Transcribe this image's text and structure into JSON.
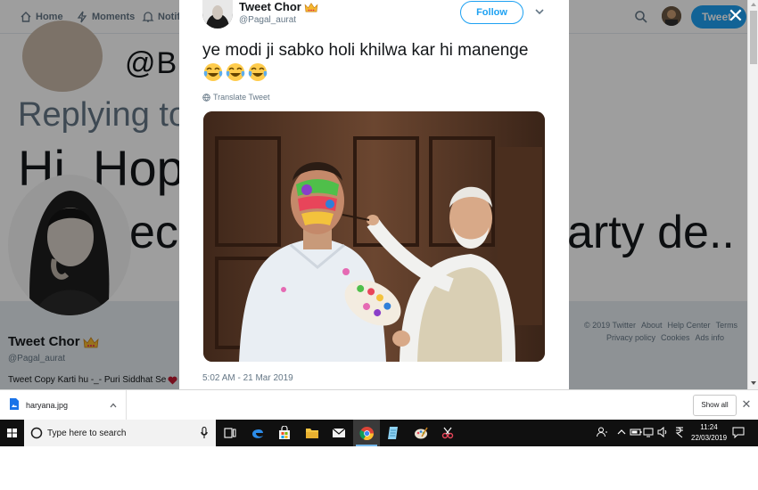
{
  "background_page": {
    "nav": {
      "home": "Home",
      "moments": "Moments",
      "notifications": "Notif",
      "tweet_button": "Tweet"
    },
    "banner": {
      "handle_fragment": "@Bi",
      "replying_to": "Replying to @",
      "hope_text": "Hi, Hope",
      "line2_left": "ec",
      "line2_right": "arty de.."
    },
    "profile": {
      "name": "Tweet Chor",
      "handle": "@Pagal_aurat",
      "bio": "Tweet Copy Karti hu -_- Puri Siddhat Se"
    },
    "footer": {
      "links": [
        "© 2019 Twitter",
        "About",
        "Help Center",
        "Terms",
        "Privacy policy",
        "Cookies",
        "Ads info"
      ]
    }
  },
  "modal": {
    "close_label": "✕",
    "author_name": "Tweet Chor",
    "author_handle": "@Pagal_aurat",
    "follow_label": "Follow",
    "tweet_text": "ye modi ji sabko holi khilwa kar hi manenge",
    "emojis": [
      "face-with-tears-of-joy",
      "face-with-tears-of-joy",
      "face-with-tears-of-joy"
    ],
    "translate_label": "Translate Tweet",
    "timestamp": "5:02 AM - 21 Mar 2019"
  },
  "download_bar": {
    "file_name": "haryana.jpg",
    "show_all_label": "Show all",
    "close_label": "✕"
  },
  "taskbar": {
    "search_placeholder": "Type here to search",
    "time": "11:24",
    "date": "22/03/2019",
    "apps": [
      "task-view",
      "edge",
      "store",
      "file-explorer",
      "mail",
      "chrome",
      "notepad",
      "paint",
      "snipping-tool"
    ]
  },
  "colors": {
    "twitter_blue": "#1da1f2",
    "taskbar": "#101010",
    "text_primary": "#14171a",
    "text_secondary": "#657786"
  }
}
